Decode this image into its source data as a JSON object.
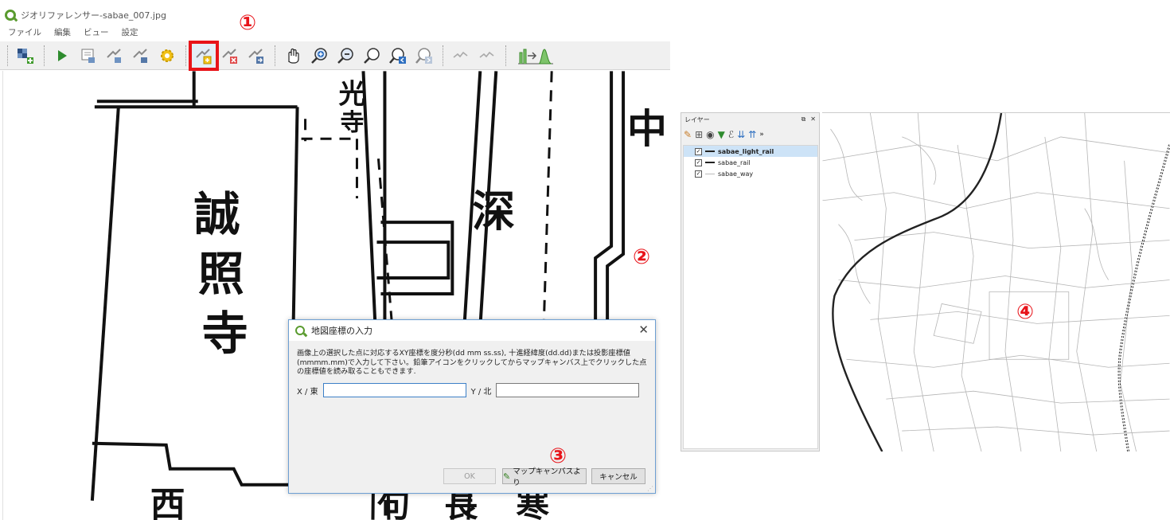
{
  "georef": {
    "title": "ジオリファレンサー-sabae_007.jpg",
    "menus": [
      "ファイル",
      "編集",
      "ビュー",
      "設定"
    ],
    "toolbar_icons": [
      "open-raster-icon",
      "start-georeferencing-icon",
      "generate-gdal-script-icon",
      "load-gcp-icon",
      "save-gcp-icon",
      "transformation-settings-icon",
      "add-point-icon",
      "delete-point-icon",
      "move-gcp-icon",
      "pan-icon",
      "zoom-in-icon",
      "zoom-out-icon",
      "zoom-to-layer-icon",
      "zoom-last-icon",
      "zoom-next-icon",
      "link-georef-icon",
      "link-qgis-icon",
      "histogram-icon"
    ],
    "map_text": [
      "光",
      "寺",
      "誠",
      "照",
      "寺",
      "深",
      "中",
      "西",
      "句",
      "長",
      "寒"
    ]
  },
  "markers": {
    "m1": "①",
    "m2": "②",
    "m3": "③",
    "m4": "④"
  },
  "dialog": {
    "title": "地図座標の入力",
    "description": "画像上の選択した点に対応するXY座標を度分秒(dd mm ss.ss), 十進経緯度(dd.dd)または投影座標値(mmmm.mm)で入力して下さい。鉛筆アイコンをクリックしてからマップキャンバス上でクリックした点の座標値を読み取ることもできます.",
    "x_label": "X / 東",
    "y_label": "Y / 北",
    "x_value": "",
    "y_value": "",
    "ok": "OK",
    "from_canvas": "マップキャンバスより",
    "cancel": "キャンセル"
  },
  "layers_panel": {
    "title": "レイヤー",
    "layers": [
      {
        "name": "sabae_light_rail",
        "checked": true,
        "selected": true,
        "symbol": "solid"
      },
      {
        "name": "sabae_rail",
        "checked": true,
        "selected": false,
        "symbol": "dashed"
      },
      {
        "name": "sabae_way",
        "checked": true,
        "selected": false,
        "symbol": "thin"
      }
    ]
  },
  "colors": {
    "marker_red": "#e8141a",
    "highlight_box": "#e8141a",
    "dialog_border": "#6d9fd3"
  }
}
